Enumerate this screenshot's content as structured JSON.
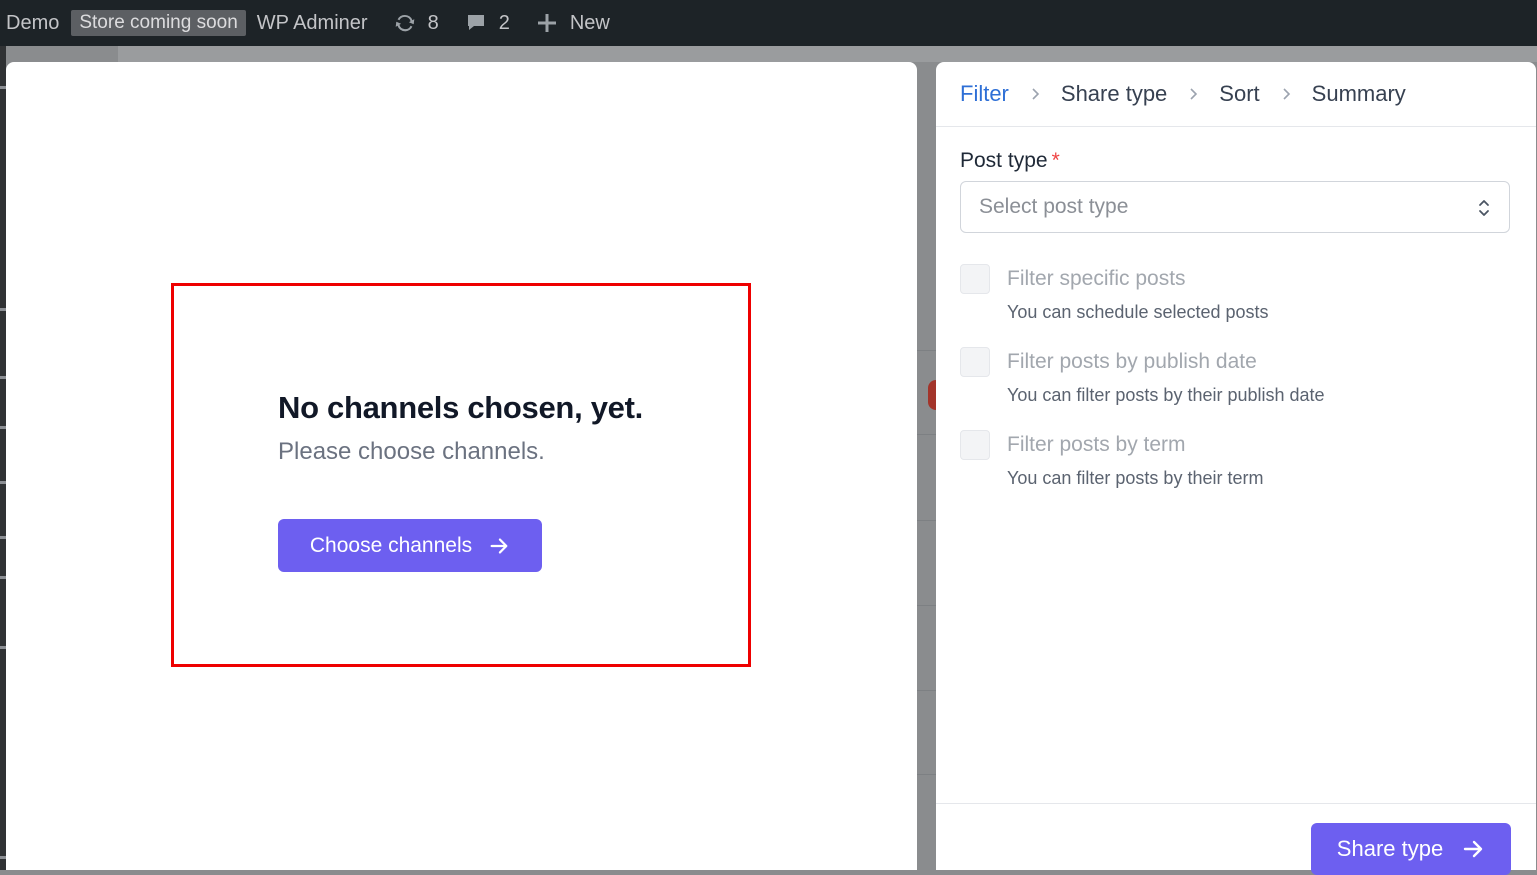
{
  "adminbar": {
    "site": "Demo",
    "store_badge": "Store coming soon",
    "adminer": "WP Adminer",
    "updates_count": "8",
    "comments_count": "2",
    "new_label": "New"
  },
  "channels": {
    "empty_title": "No channels chosen, yet.",
    "empty_subtitle": "Please choose channels.",
    "choose_button": "Choose channels"
  },
  "wizard": {
    "steps": [
      "Filter",
      "Share type",
      "Sort",
      "Summary"
    ],
    "active_step": "Filter",
    "post_type": {
      "label": "Post type",
      "required_mark": "*",
      "placeholder": "Select post type"
    },
    "options": [
      {
        "title": "Filter specific posts",
        "description": "You can schedule selected posts"
      },
      {
        "title": "Filter posts by publish date",
        "description": "You can filter posts by their publish date"
      },
      {
        "title": "Filter posts by term",
        "description": "You can filter posts by their term"
      }
    ],
    "next_button": "Share type"
  },
  "colors": {
    "primary": "#6d5ff0",
    "active_step": "#2e6fd6",
    "required": "#ef4444",
    "highlight": "#ee0000",
    "adminbar": "#1d2327"
  }
}
